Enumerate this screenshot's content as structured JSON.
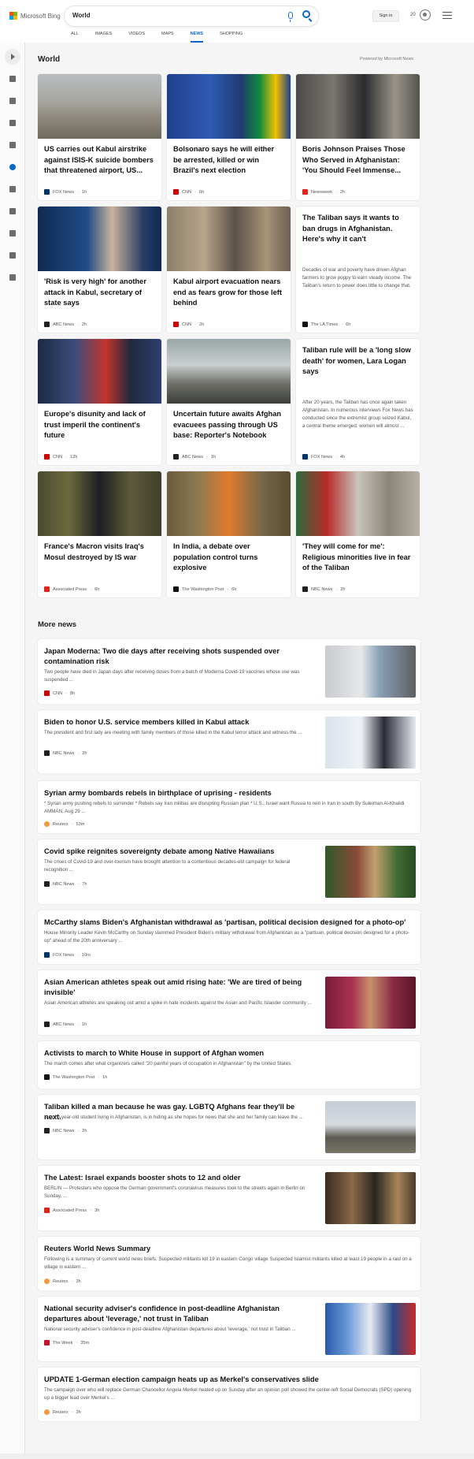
{
  "header": {
    "brand": "Microsoft Bing",
    "query": "World",
    "signin_label": "Sign in",
    "points": "20"
  },
  "tabs": [
    "ALL",
    "IMAGES",
    "VIDEOS",
    "MAPS",
    "NEWS",
    "SHOPPING"
  ],
  "active_tab": "NEWS",
  "section": {
    "title": "World",
    "powered": "Powered by Microsoft News"
  },
  "cards": [
    {
      "title": "US carries out Kabul airstrike against ISIS-K suicide bombers that threatened airport, US...",
      "source": "FOX News",
      "age": "1h",
      "logo_color": "#003366"
    },
    {
      "title": "Bolsonaro says he will either be arrested, killed or win Brazil's next election",
      "source": "CNN",
      "age": "6h",
      "logo_color": "#cc0000"
    },
    {
      "title": "Boris Johnson Praises Those Who Served in Afghanistan: 'You Should Feel Immense...",
      "source": "Newsweek",
      "age": "2h",
      "logo_color": "#e2231a"
    },
    {
      "title": "'Risk is very high' for another attack in Kabul, secretary of state says",
      "source": "ABC News",
      "age": "2h",
      "logo_color": "#222222"
    },
    {
      "title": "Kabul airport evacuation nears end as fears grow for those left behind",
      "source": "CNN",
      "age": "2h",
      "logo_color": "#cc0000"
    },
    {
      "title": "The Taliban says it wants to ban drugs in Afghanistan. Here's why it can't",
      "abstract": "Decades of war and poverty have driven Afghan farmers to grow poppy to earn steady income. The Taliban's return to power does little to change that.",
      "source": "The LA Times",
      "age": "6h",
      "logo_color": "#111111"
    },
    {
      "title": "Europe's disunity and lack of trust imperil the continent's future",
      "source": "CNN",
      "age": "12h",
      "logo_color": "#cc0000"
    },
    {
      "title": "Uncertain future awaits Afghan evacuees passing through US base: Reporter's Notebook",
      "source": "ABC News",
      "age": "1h",
      "logo_color": "#222222"
    },
    {
      "title": "Taliban rule will be a 'long slow death' for women, Lara Logan says",
      "abstract": "After 20 years, the Taliban has once again taken Afghanistan. In numerous interviews Fox News has conducted since the extremist group seized Kabul, a central theme emerged: women will almost ...",
      "source": "FOX News",
      "age": "4h",
      "logo_color": "#003366"
    },
    {
      "title": "France's Macron visits Iraq's Mosul destroyed by IS war",
      "source": "Associated Press",
      "age": "6h",
      "logo_color": "#e2231a"
    },
    {
      "title": "In India, a debate over population control turns explosive",
      "source": "The Washington Post",
      "age": "6h",
      "logo_color": "#111111"
    },
    {
      "title": "'They will come for me': Religious minorities live in fear of the Taliban",
      "source": "NBC News",
      "age": "2h",
      "logo_color": "#222222"
    }
  ],
  "more": {
    "title": "More news",
    "items": [
      {
        "title": "Japan Moderna: Two die days after receiving shots suspended over contamination risk",
        "snippet": "Two people have died in Japan days after receiving doses from a batch of Moderna Covid-19 vaccines whose use was suspended ...",
        "source": "CNN",
        "age": "8h",
        "logo_color": "#cc0000"
      },
      {
        "title": "Biden to honor U.S. service members killed in Kabul attack",
        "snippet": "The president and first lady are meeting with family members of those killed in the Kabul terror attack and witness the ...",
        "source": "NBC News",
        "age": "2h",
        "logo_color": "#222222"
      },
      {
        "title": "Syrian army bombards rebels in birthplace of uprising - residents",
        "snippet": "* Syrian army pushing rebels to surrender * Rebels say Iran militias are disrupting Russian plan * U.S., Israel want Russia to rein in Iran in south By Suleiman Al-Khalidi AMMAN, Aug 29 ...",
        "source": "Reuters",
        "age": "53m",
        "logo_color": "#f39a3e"
      },
      {
        "title": "Covid spike reignites sovereignty debate among Native Hawaiians",
        "snippet": "The crises of Covid-19 and over-tourism have brought attention to a contentious decades-old campaign for federal recognition ...",
        "source": "NBC News",
        "age": "7h",
        "logo_color": "#222222"
      },
      {
        "title": "McCarthy slams Biden's Afghanistan withdrawal as 'partisan, political decision designed for a photo-op'",
        "snippet": "House Minority Leader Kevin McCarthy on Sunday slammed President Biden's military withdrawal from Afghanistan as a \"partisan, political decision designed for a photo-op\" ahead of the 20th anniversary ...",
        "source": "FOX News",
        "age": "10m",
        "logo_color": "#003366"
      },
      {
        "title": "Asian American athletes speak out amid rising hate: 'We are tired of being invisible'",
        "snippet": "Asian American athletes are speaking out amid a spike in hate incidents against the Asian and Pacific Islander community ...",
        "source": "ABC News",
        "age": "1h",
        "logo_color": "#222222"
      },
      {
        "title": "Activists to march to White House in support of Afghan women",
        "snippet": "The march comes after what organizers called \"20 painful years of occupation in Afghanistan\" by the United States.",
        "source": "The Washington Post",
        "age": "1h",
        "logo_color": "#111111"
      },
      {
        "title": "Taliban killed a man because he was gay. LGBTQ Afghans fear they'll be next.",
        "snippet": "N, a 20-year-old student living in Afghanistan, is in hiding as she hopes for news that she and her family can leave the ...",
        "source": "NBC News",
        "age": "2h",
        "logo_color": "#222222"
      },
      {
        "title": "The Latest: Israel expands booster shots to 12 and older",
        "snippet": "BERLIN — Protesters who oppose the German government's coronavirus measures took to the streets again in Berlin on Sunday, ...",
        "source": "Associated Press",
        "age": "3h",
        "logo_color": "#e2231a"
      },
      {
        "title": "Reuters World News Summary",
        "snippet": "Following is a summary of current world news briefs. Suspected militants kill 19 in eastern Congo village Suspected Islamist militants killed at least 19 people in a raid on a village in eastern ...",
        "source": "Reuters",
        "age": "3h",
        "logo_color": "#f39a3e"
      },
      {
        "title": "National security adviser's confidence in post-deadline Afghanistan departures about 'leverage,' not trust in Taliban",
        "snippet": "National security adviser's confidence in post-deadline Afghanistan departures about 'leverage,' not trust in Taliban ...",
        "source": "The Week",
        "age": "35m",
        "logo_color": "#c8102e"
      },
      {
        "title": "UPDATE 1-German election campaign heats up as Merkel's conservatives slide",
        "snippet": "The campaign over who will replace German Chancellor Angela Merkel heated up on Sunday after an opinion poll showed the center-left Social Democrats (SPD) opening up a bigger lead over Merkel's ...",
        "source": "Reuters",
        "age": "3h",
        "logo_color": "#f39a3e"
      }
    ]
  },
  "colors": {
    "accent": "#0c66c7",
    "background": "#f5f5f5"
  }
}
